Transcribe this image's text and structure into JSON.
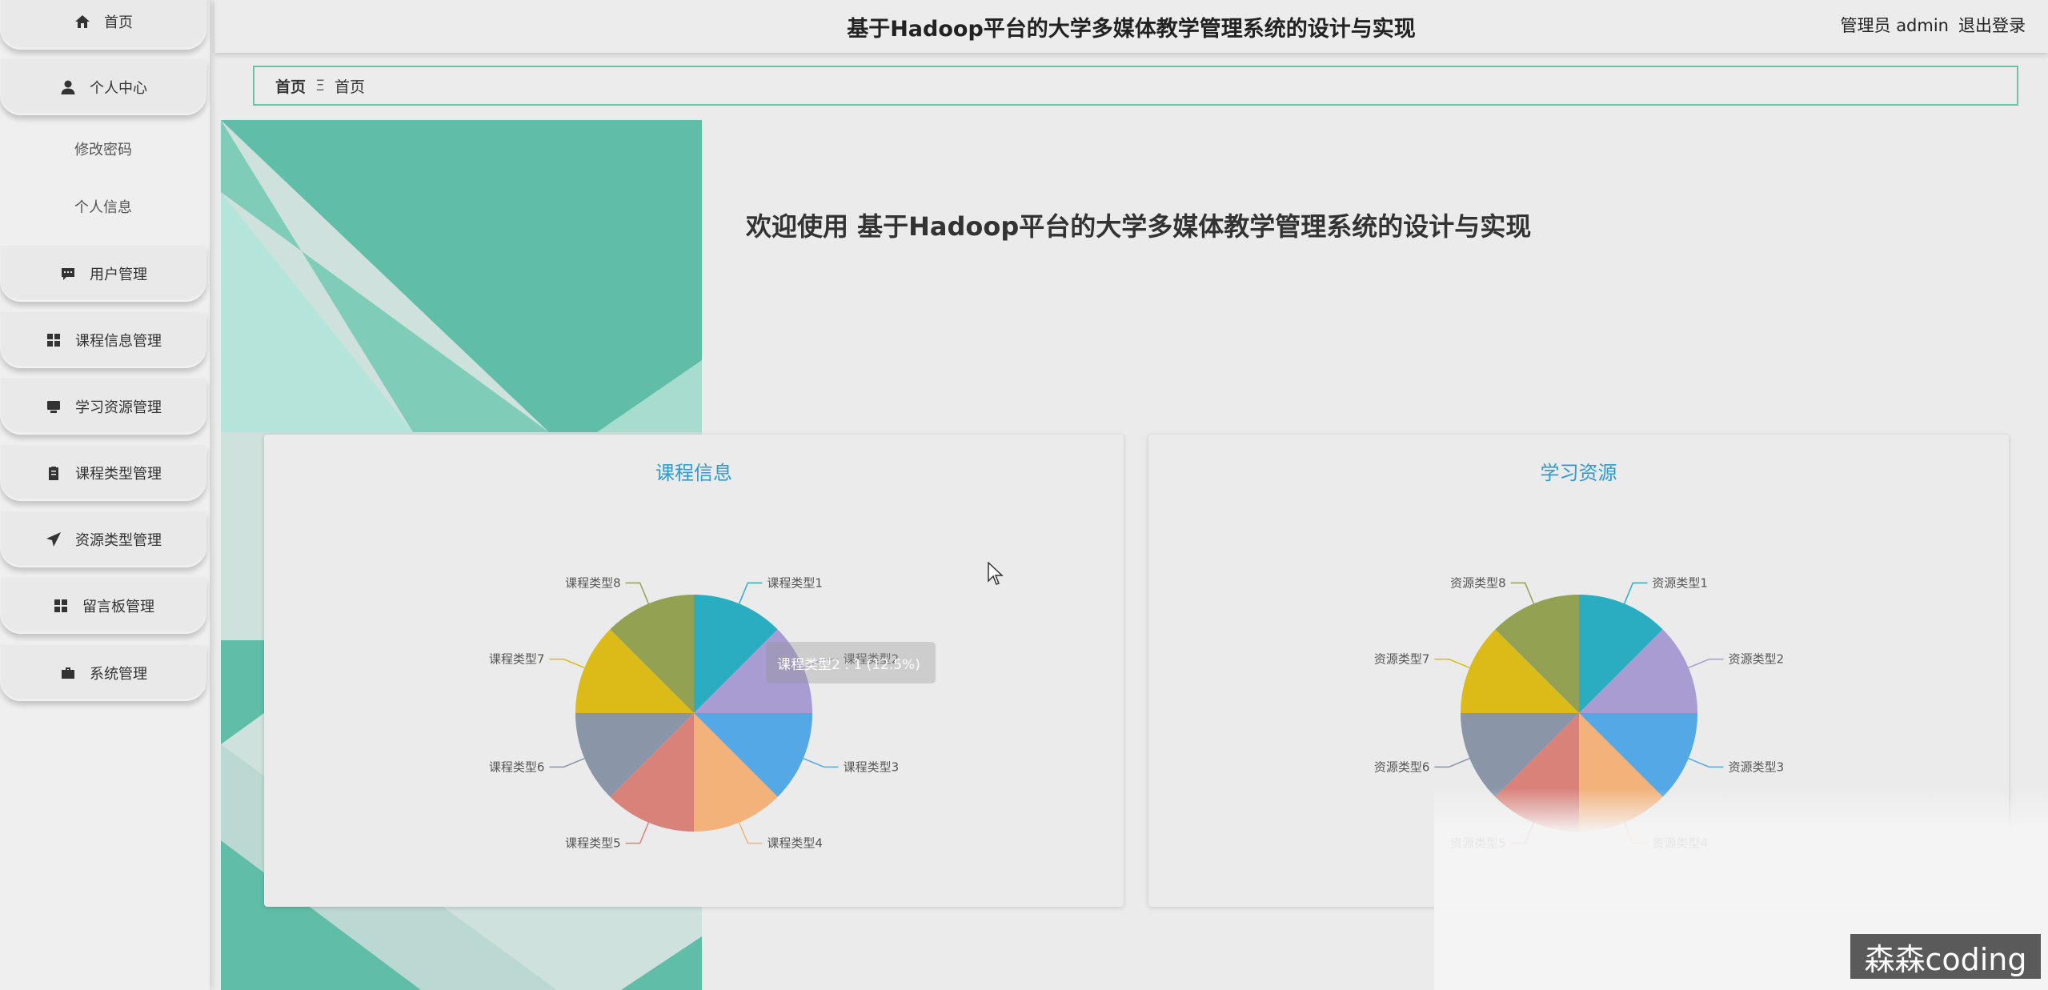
{
  "sidebar": {
    "items": [
      {
        "label": "首页",
        "icon": "home-icon"
      },
      {
        "label": "个人中心",
        "icon": "user-icon"
      },
      {
        "label": "修改密码"
      },
      {
        "label": "个人信息"
      },
      {
        "label": "用户管理",
        "icon": "message-icon"
      },
      {
        "label": "课程信息管理",
        "icon": "grid-icon"
      },
      {
        "label": "学习资源管理",
        "icon": "monitor-icon"
      },
      {
        "label": "课程类型管理",
        "icon": "clipboard-icon"
      },
      {
        "label": "资源类型管理",
        "icon": "send-icon"
      },
      {
        "label": "留言板管理",
        "icon": "grid-icon"
      },
      {
        "label": "系统管理",
        "icon": "briefcase-icon"
      }
    ]
  },
  "header": {
    "title": "基于Hadoop平台的大学多媒体教学管理系统的设计与实现",
    "admin": "管理员 admin",
    "logout": "退出登录"
  },
  "breadcrumb": {
    "home": "首页",
    "separator": "Ξ",
    "current": "首页"
  },
  "welcome": "欢迎使用 基于Hadoop平台的大学多媒体教学管理系统的设计与实现",
  "tooltip": {
    "text": "课程类型2 : 1 (12.5%)"
  },
  "watermark": "森森coding",
  "colors": {
    "accent": "#5cbda7",
    "title_blue": "#2f9ad0",
    "border": "#6ac3a7"
  },
  "chart_data": [
    {
      "type": "pie",
      "title": "课程信息",
      "categories": [
        "课程类型1",
        "课程类型2",
        "课程类型3",
        "课程类型4",
        "课程类型5",
        "课程类型6",
        "课程类型7",
        "课程类型8"
      ],
      "values": [
        1,
        1,
        1,
        1,
        1,
        1,
        1,
        1
      ],
      "colors": [
        "#2aadc1",
        "#a89cd2",
        "#54a8e5",
        "#f2b27a",
        "#d8827a",
        "#8a95a8",
        "#dcbb19",
        "#93a252"
      ]
    },
    {
      "type": "pie",
      "title": "学习资源",
      "categories": [
        "资源类型1",
        "资源类型2",
        "资源类型3",
        "资源类型4",
        "资源类型5",
        "资源类型6",
        "资源类型7",
        "资源类型8"
      ],
      "values": [
        1,
        1,
        1,
        1,
        1,
        1,
        1,
        1
      ],
      "colors": [
        "#2aadc1",
        "#a89cd2",
        "#54a8e5",
        "#f2b27a",
        "#d8827a",
        "#8a95a8",
        "#dcbb19",
        "#93a252"
      ]
    }
  ]
}
